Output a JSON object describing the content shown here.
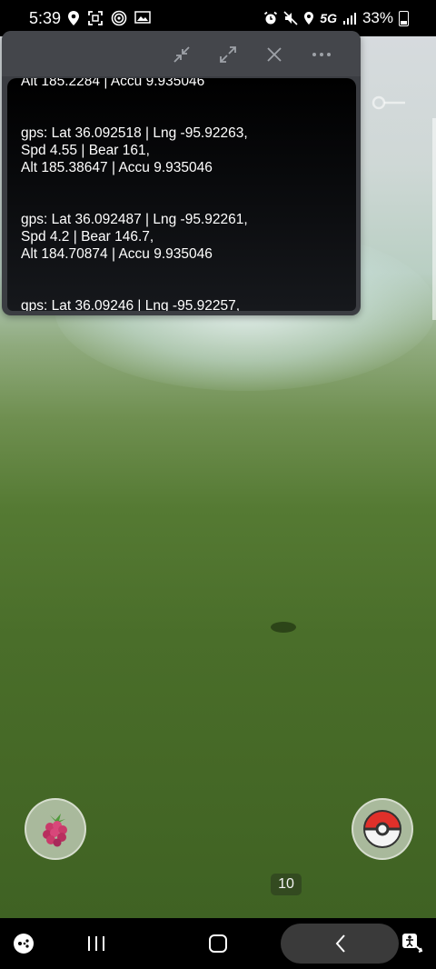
{
  "status_bar": {
    "time": "5:39",
    "left_icons": [
      "location-icon",
      "screenshot-icon",
      "nfc-icon",
      "gallery-icon"
    ],
    "right_icons": [
      "alarm-icon",
      "mute-icon",
      "location-icon",
      "5g-icon",
      "signal-icon"
    ],
    "network": "5G",
    "battery": "33%"
  },
  "popup": {
    "toolbar": [
      "collapse-icon",
      "expand-icon",
      "close-icon",
      "more-icon"
    ],
    "log": [
      {
        "lines": [
          "Alt 185.2284 | Accu 9.935046"
        ]
      },
      {
        "lines": [
          "gps: Lat 36.092518 | Lng -95.92263,",
          "Spd 4.55 | Bear 161,",
          "Alt 185.38647 | Accu 9.935046"
        ]
      },
      {
        "lines": [
          "gps: Lat 36.092487 | Lng -95.92261,",
          "Spd 4.2 | Bear 146.7,",
          "Alt 184.70874 | Accu 9.935046"
        ]
      },
      {
        "lines": [
          "gps: Lat 36.09246 | Lng -95.92257,"
        ]
      }
    ]
  },
  "game": {
    "item_count": "10",
    "left_button_icon": "raspberry-icon",
    "right_button_icon": "pokeball-icon"
  },
  "nav_bar": {
    "icons": [
      "game-launcher-icon",
      "recents-icon",
      "home-icon",
      "back-icon",
      "accessibility-icon"
    ]
  }
}
